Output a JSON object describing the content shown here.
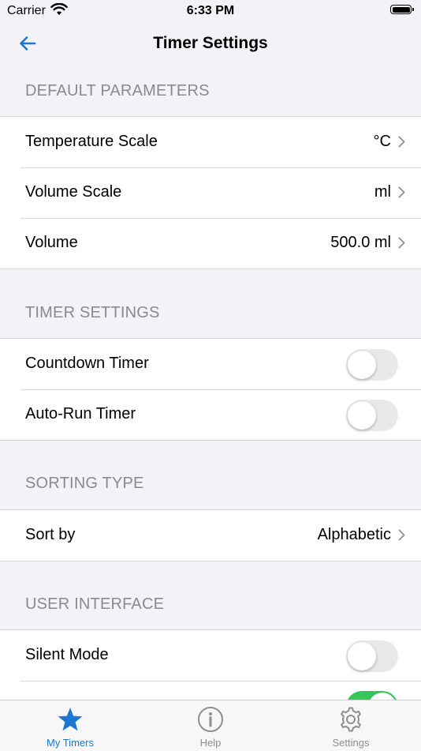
{
  "status_bar": {
    "carrier": "Carrier",
    "time": "6:33 PM"
  },
  "nav": {
    "title": "Timer Settings",
    "back_icon": "arrow-left-icon"
  },
  "sections": {
    "default_parameters": {
      "header": "DEFAULT PARAMETERS",
      "rows": [
        {
          "label": "Temperature Scale",
          "value": "°C"
        },
        {
          "label": "Volume Scale",
          "value": "ml"
        },
        {
          "label": "Volume",
          "value": "500.0 ml"
        }
      ]
    },
    "timer_settings": {
      "header": "TIMER SETTINGS",
      "rows": [
        {
          "label": "Countdown Timer",
          "on": false
        },
        {
          "label": "Auto-Run Timer",
          "on": false
        }
      ]
    },
    "sorting_type": {
      "header": "SORTING TYPE",
      "rows": [
        {
          "label": "Sort by",
          "value": "Alphabetic"
        }
      ]
    },
    "user_interface": {
      "header": "USER INTERFACE",
      "rows": [
        {
          "label": "Silent Mode",
          "on": false
        },
        {
          "label": "",
          "on": true
        }
      ]
    }
  },
  "tabbar": {
    "tabs": [
      {
        "label": "My Timers",
        "icon": "star-icon",
        "active": true
      },
      {
        "label": "Help",
        "icon": "info-circle-icon",
        "active": false
      },
      {
        "label": "Settings",
        "icon": "gear-icon",
        "active": false
      }
    ]
  },
  "colors": {
    "accent": "#1c76d2",
    "toggle_on": "#34c759",
    "toggle_off": "#e9e9eb",
    "background": "#f2f2f7"
  }
}
